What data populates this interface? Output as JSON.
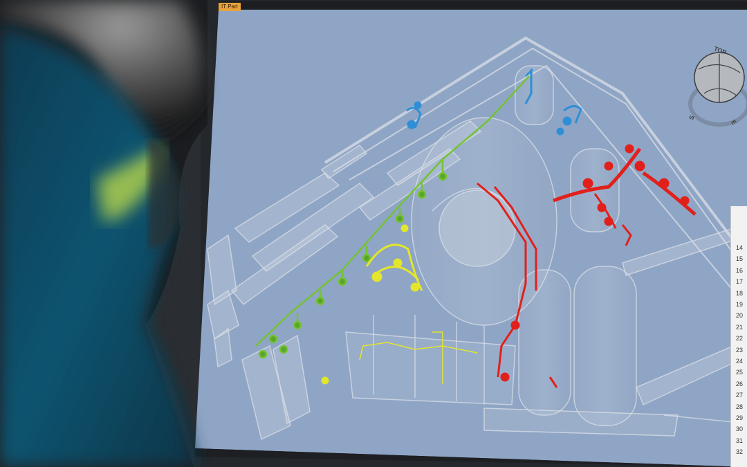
{
  "viewport": {
    "tab_label": "IT Part",
    "background_color": "#8ea4c4",
    "navigation_cube": {
      "face_label": "TOP",
      "compass": [
        "S",
        "E"
      ]
    }
  },
  "pipe_systems": [
    {
      "name": "green",
      "color": "#7ec53a"
    },
    {
      "name": "yellow",
      "color": "#e2e62b"
    },
    {
      "name": "blue",
      "color": "#2d8fd8"
    },
    {
      "name": "red",
      "color": "#e0211d"
    }
  ],
  "spreadsheet": {
    "row_numbers": [
      "14",
      "15",
      "16",
      "17",
      "18",
      "19",
      "20",
      "21",
      "22",
      "23",
      "24",
      "25",
      "26",
      "27",
      "28",
      "29",
      "30",
      "31",
      "32"
    ]
  }
}
